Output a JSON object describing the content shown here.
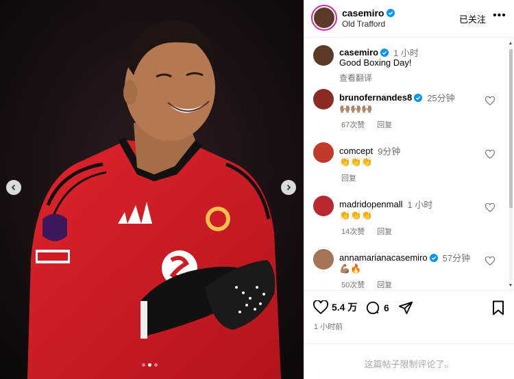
{
  "post": {
    "author": "casemiro",
    "location": "Old Trafford",
    "follow_label": "已关注",
    "more_icon": "more-icon",
    "caption_author": "casemiro",
    "caption_time": "1 小时",
    "caption_text": "Good Boxing Day!",
    "translate_label": "查看翻译"
  },
  "comments": [
    {
      "user": "brunofernandes8",
      "verified": true,
      "time": "25分钟",
      "text": "🙌🏽🙌🏽🙌🏽",
      "likes": "67次赞",
      "reply": "回复",
      "avatar_color": "#8a2a22"
    },
    {
      "user": "comcept",
      "verified": false,
      "time": "9分钟",
      "text": "👏👏👏",
      "likes": "",
      "reply": "回复",
      "avatar_color": "#c0392b"
    },
    {
      "user": "madridopenmall",
      "verified": false,
      "time": "1 小时",
      "text": "👏👏👏",
      "likes": "14次赞",
      "reply": "回复",
      "avatar_color": "#b8282e"
    },
    {
      "user": "annamarianacasemiro",
      "verified": true,
      "time": "57分钟",
      "text": "💪🏽🔥",
      "likes": "50次赞",
      "reply": "回复",
      "avatar_color": "#a87456"
    }
  ],
  "actions": {
    "like_count": "5.4 万",
    "comment_count": "6",
    "posted_ago": "1 小时前"
  },
  "footer": {
    "limited_text": "这篇帖子限制评论了。"
  },
  "carousel": {
    "total": 3,
    "active": 2
  },
  "colors": {
    "kit_red": "#d11a23",
    "verified_blue": "#0095f6",
    "muted": "#737373"
  }
}
